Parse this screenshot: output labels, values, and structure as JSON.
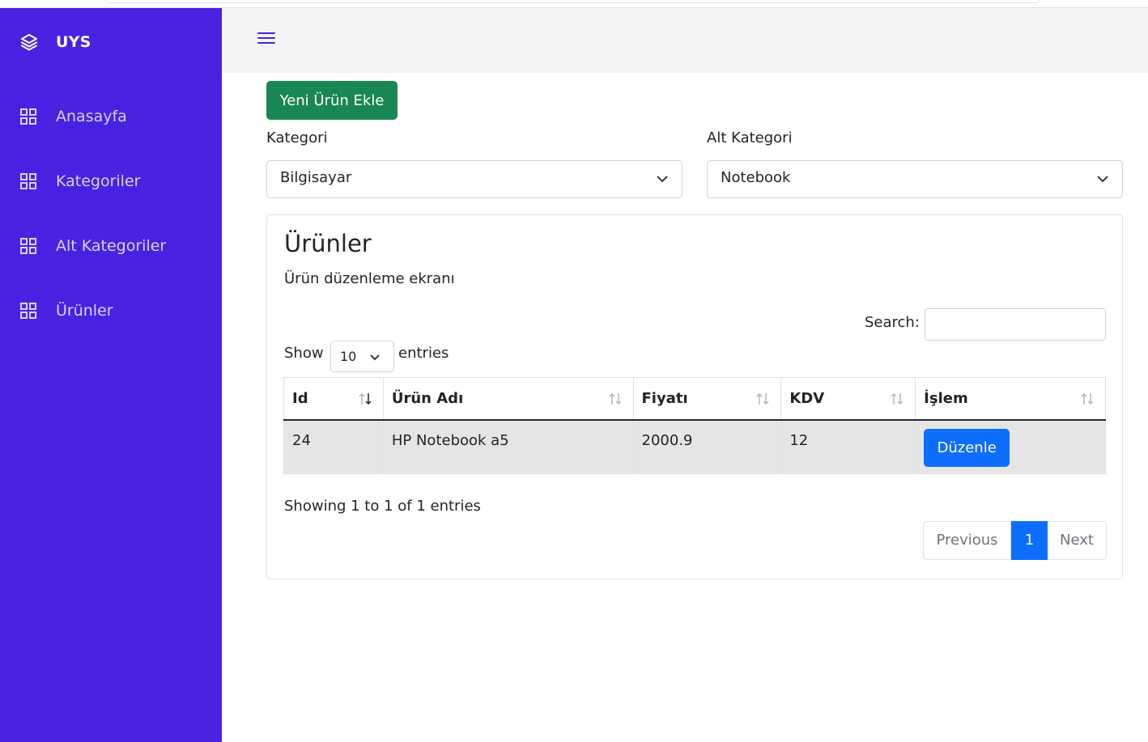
{
  "sidebar": {
    "brand": "UYS",
    "items": [
      {
        "label": "Anasayfa",
        "icon": "grid-icon"
      },
      {
        "label": "Kategoriler",
        "icon": "grid-icon"
      },
      {
        "label": "Alt Kategoriler",
        "icon": "grid-icon"
      },
      {
        "label": "Ürünler",
        "icon": "grid-icon"
      }
    ]
  },
  "topbar": {
    "menu_icon": "hamburger-icon"
  },
  "toolbar": {
    "new_product_label": "Yeni Ürün Ekle"
  },
  "filters": {
    "category_label": "Kategori",
    "category_value": "Bilgisayar",
    "subcategory_label": "Alt Kategori",
    "subcategory_value": "Notebook"
  },
  "card": {
    "title": "Ürünler",
    "subtitle": "Ürün düzenleme ekranı",
    "search_label": "Search:",
    "search_value": "",
    "show_label": "Show",
    "page_length": "10",
    "entries_label": "entries",
    "columns": [
      "Id",
      "Ürün Adı",
      "Fiyatı",
      "KDV",
      "İşlem"
    ],
    "rows": [
      {
        "id": "24",
        "name": "HP Notebook a5",
        "price": "2000.9",
        "kdv": "12",
        "action": "Düzenle"
      }
    ],
    "info": "Showing 1 to 1 of 1 entries",
    "pagination": {
      "previous": "Previous",
      "current": "1",
      "next": "Next"
    }
  },
  "colors": {
    "sidebar": "#4822e0",
    "success": "#198754",
    "primary": "#0d6efd"
  }
}
